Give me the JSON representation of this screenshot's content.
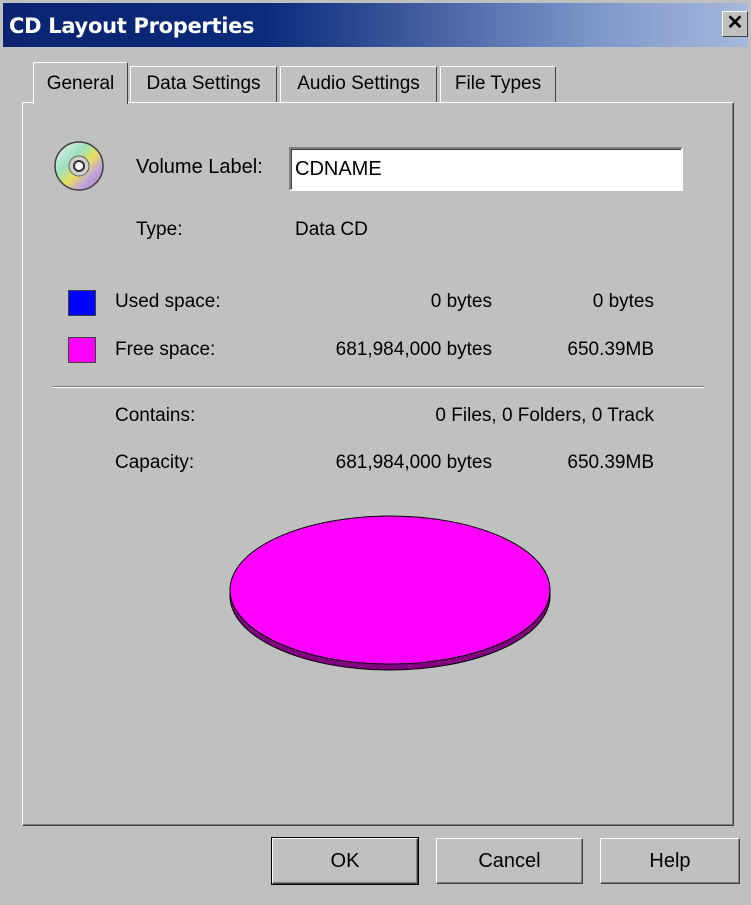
{
  "window": {
    "title": "CD Layout Properties",
    "close_glyph": "✕"
  },
  "tabs": [
    {
      "label": "General",
      "active": true
    },
    {
      "label": "Data Settings",
      "active": false
    },
    {
      "label": "Audio Settings",
      "active": false
    },
    {
      "label": "File Types",
      "active": false
    }
  ],
  "general": {
    "volume_label_caption": "Volume Label:",
    "volume_label_value": "CDNAME",
    "type_caption": "Type:",
    "type_value": "Data CD",
    "used_space": {
      "caption": "Used space:",
      "bytes": "0 bytes",
      "size": "0 bytes",
      "color": "#0000ff"
    },
    "free_space": {
      "caption": "Free space:",
      "bytes": "681,984,000 bytes",
      "size": "650.39MB",
      "color": "#ff00ff"
    },
    "contains_caption": "Contains:",
    "contains_value": "0 Files, 0 Folders, 0 Track",
    "capacity_caption": "Capacity:",
    "capacity_bytes": "681,984,000 bytes",
    "capacity_size": "650.39MB",
    "pie": {
      "used_fraction": 0.0,
      "free_fraction": 1.0,
      "free_color": "#ff00ff",
      "edge_color": "#800080"
    }
  },
  "buttons": {
    "ok": "OK",
    "cancel": "Cancel",
    "help": "Help"
  },
  "icons": {
    "cd": "cd-disc-icon",
    "close": "close-icon"
  }
}
